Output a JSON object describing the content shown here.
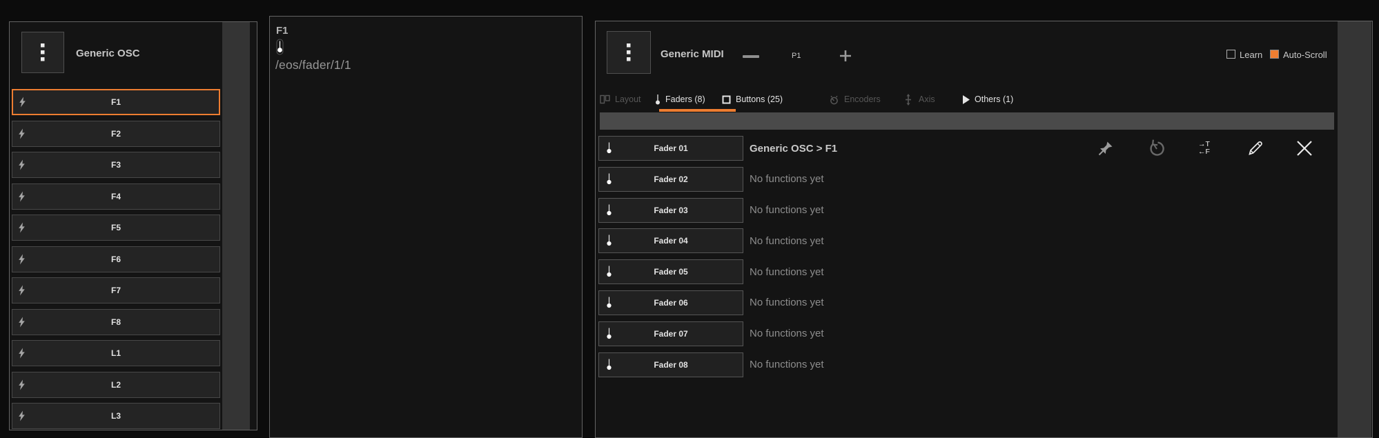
{
  "colors": {
    "accent": "#ED7D31",
    "panel_bg": "#141414",
    "background": "#0c0c0c"
  },
  "left_panel": {
    "title": "Generic OSC",
    "items": [
      {
        "label": "F1",
        "selected": true
      },
      {
        "label": "F2"
      },
      {
        "label": "F3"
      },
      {
        "label": "F4"
      },
      {
        "label": "F5"
      },
      {
        "label": "F6"
      },
      {
        "label": "F7"
      },
      {
        "label": "F8"
      },
      {
        "label": "L1"
      },
      {
        "label": "L2"
      },
      {
        "label": "L3"
      }
    ]
  },
  "detail_panel": {
    "title": "F1",
    "address": "/eos/fader/1/1"
  },
  "right_panel": {
    "title": "Generic MIDI",
    "page_label": "P1",
    "learn_label": "Learn",
    "autoscroll_label": "Auto-Scroll",
    "tabs": [
      {
        "label": "Layout",
        "icon": "layout-icon",
        "state": "disabled"
      },
      {
        "label": "Faders (8)",
        "icon": "fader-icon",
        "state": "active"
      },
      {
        "label": "Buttons (25)",
        "icon": "button-icon",
        "state": "normal"
      },
      {
        "label": "Encoders",
        "icon": "encoder-icon",
        "state": "disabled"
      },
      {
        "label": "Axis",
        "icon": "axis-icon",
        "state": "disabled"
      },
      {
        "label": "Others (1)",
        "icon": "play-icon",
        "state": "normal"
      }
    ],
    "actions": {
      "tf_line1": "→T",
      "tf_line2": "←F"
    },
    "rows": [
      {
        "label": "Fader 01",
        "function": "Generic OSC > F1",
        "mapped": true
      },
      {
        "label": "Fader 02",
        "function": "No functions yet"
      },
      {
        "label": "Fader 03",
        "function": "No functions yet"
      },
      {
        "label": "Fader 04",
        "function": "No functions yet"
      },
      {
        "label": "Fader 05",
        "function": "No functions yet"
      },
      {
        "label": "Fader 06",
        "function": "No functions yet"
      },
      {
        "label": "Fader 07",
        "function": "No functions yet"
      },
      {
        "label": "Fader 08",
        "function": "No functions yet"
      }
    ]
  }
}
